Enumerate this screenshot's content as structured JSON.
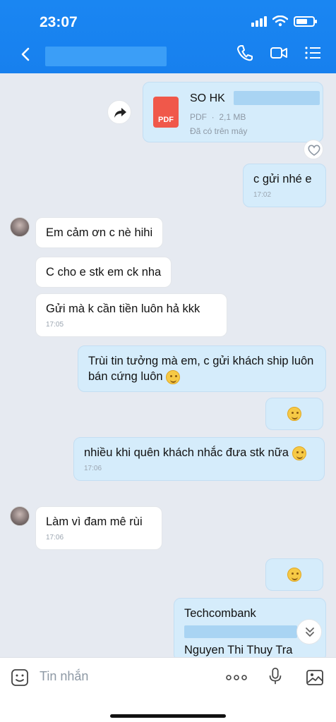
{
  "status_bar": {
    "time": "23:07"
  },
  "header": {
    "contact_name": ""
  },
  "file_message": {
    "icon_label": "PDF",
    "name": "SO HK",
    "type": "PDF",
    "size": "2,1 MB",
    "status": "Đã có trên máy"
  },
  "messages": [
    {
      "side": "out",
      "text": "c gửi nhé e",
      "time": "17:02"
    },
    {
      "side": "in",
      "text": "Em cảm ơn c nè hihi"
    },
    {
      "side": "in",
      "text": "C cho e stk em ck nha"
    },
    {
      "side": "in",
      "text": "Gửi mà k cần tiền luôn hả kkk",
      "time": "17:05"
    },
    {
      "side": "out",
      "text": "Trùi tin tưởng mà em, c gửi khách ship luôn bán cứng luôn"
    },
    {
      "side": "out",
      "text": "nhiều khi quên khách nhắc đưa stk nữa",
      "time": "17:06"
    },
    {
      "side": "in",
      "text": "Làm vì đam mê rùi",
      "time": "17:06"
    },
    {
      "side": "out",
      "text": "Techcombank"
    },
    {
      "side": "out",
      "text": "Nguyen Thi Thuy Tra"
    }
  ],
  "input": {
    "placeholder": "Tin nhắn"
  },
  "icons": {
    "back": "chevron-left-icon",
    "call": "phone-icon",
    "video": "video-icon",
    "menu": "list-menu-icon",
    "share": "share-arrow-icon",
    "react": "heart-icon",
    "scroll": "chevron-double-down-icon",
    "sticker": "sticker-icon",
    "more": "more-dots-icon",
    "mic": "microphone-icon",
    "image": "image-icon"
  },
  "colors": {
    "header": "#1780ee",
    "outgoing_bubble": "#d5ecfb",
    "incoming_bubble": "#ffffff",
    "background": "#e6eaf1"
  }
}
